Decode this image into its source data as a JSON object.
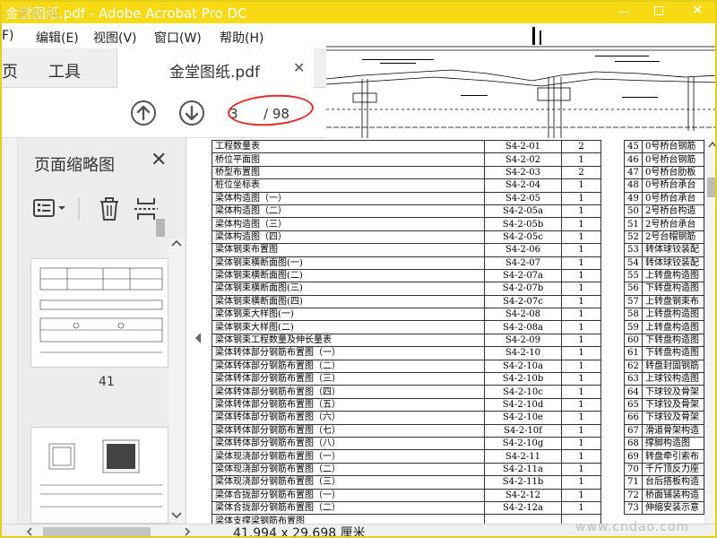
{
  "window": {
    "title": "金堂图纸.pdf - Adobe Acrobat Pro DC",
    "watermark_top": "清新网",
    "close_glyph": "✕"
  },
  "menu": {
    "items": [
      "F)",
      "编辑(E)",
      "视图(V)",
      "窗口(W)",
      "帮助(H)"
    ]
  },
  "tabs": {
    "home": "页",
    "tools": "工具",
    "document": "金堂图纸.pdf",
    "close_glyph": "✕"
  },
  "toolbar": {
    "prev_icon": "arrow-up-icon",
    "next_icon": "arrow-down-icon",
    "page_current": "3",
    "page_total": "/ 98"
  },
  "thumbnail_panel": {
    "title": "页面缩略图",
    "close_glyph": "✕",
    "page_label": "41"
  },
  "document": {
    "left_rows": [
      {
        "name": "工程数量表",
        "code": "S4-2-01",
        "sheets": "2"
      },
      {
        "name": "桥位平面图",
        "code": "S4-2-02",
        "sheets": "1"
      },
      {
        "name": "桥型布置图",
        "code": "S4-2-03",
        "sheets": "2"
      },
      {
        "name": "桩位坐标表",
        "code": "S4-2-04",
        "sheets": "1"
      },
      {
        "name": "梁体构造图（一）",
        "code": "S4-2-05",
        "sheets": "1"
      },
      {
        "name": "梁体构造图（二）",
        "code": "S4-2-05a",
        "sheets": "1"
      },
      {
        "name": "梁体构造图（三）",
        "code": "S4-2-05b",
        "sheets": "1"
      },
      {
        "name": "梁体构造图（四）",
        "code": "S4-2-05c",
        "sheets": "1"
      },
      {
        "name": "梁体钢束布置图",
        "code": "S4-2-06",
        "sheets": "1"
      },
      {
        "name": "梁体钢束横断面图(一)",
        "code": "S4-2-07",
        "sheets": "1"
      },
      {
        "name": "梁体钢束横断面图(二)",
        "code": "S4-2-07a",
        "sheets": "1"
      },
      {
        "name": "梁体钢束横断面图(三)",
        "code": "S4-2-07b",
        "sheets": "1"
      },
      {
        "name": "梁体钢束横断面图(四)",
        "code": "S4-2-07c",
        "sheets": "1"
      },
      {
        "name": "梁体钢束大样图(一)",
        "code": "S4-2-08",
        "sheets": "1"
      },
      {
        "name": "梁体钢束大样图(二)",
        "code": "S4-2-08a",
        "sheets": "1"
      },
      {
        "name": "梁体钢束工程数量及伸长量表",
        "code": "S4-2-09",
        "sheets": "1"
      },
      {
        "name": "梁体转体部分钢筋布置图（一）",
        "code": "S4-2-10",
        "sheets": "1"
      },
      {
        "name": "梁体转体部分钢筋布置图（二）",
        "code": "S4-2-10a",
        "sheets": "1"
      },
      {
        "name": "梁体转体部分钢筋布置图（三）",
        "code": "S4-2-10b",
        "sheets": "1"
      },
      {
        "name": "梁体转体部分钢筋布置图（四）",
        "code": "S4-2-10c",
        "sheets": "1"
      },
      {
        "name": "梁体转体部分钢筋布置图（五）",
        "code": "S4-2-10d",
        "sheets": "1"
      },
      {
        "name": "梁体转体部分钢筋布置图（六）",
        "code": "S4-2-10e",
        "sheets": "1"
      },
      {
        "name": "梁体转体部分钢筋布置图（七）",
        "code": "S4-2-10f",
        "sheets": "1"
      },
      {
        "name": "梁体转体部分钢筋布置图（八）",
        "code": "S4-2-10g",
        "sheets": "1"
      },
      {
        "name": "梁体现浇部分钢筋布置图（一）",
        "code": "S4-2-11",
        "sheets": "1"
      },
      {
        "name": "梁体现浇部分钢筋布置图（二）",
        "code": "S4-2-11a",
        "sheets": "1"
      },
      {
        "name": "梁体现浇部分钢筋布置图（三）",
        "code": "S4-2-11b",
        "sheets": "1"
      },
      {
        "name": "梁体合拢部分钢筋布置图（一）",
        "code": "S4-2-12",
        "sheets": "1"
      },
      {
        "name": "梁体合拢部分钢筋布置图（二）",
        "code": "S4-2-12a",
        "sheets": "1"
      }
    ],
    "right_rows": [
      {
        "num": "45",
        "name": "0号桥台钢筋"
      },
      {
        "num": "46",
        "name": "0号桥台钢筋"
      },
      {
        "num": "47",
        "name": "0号桥台肋板"
      },
      {
        "num": "48",
        "name": "0号桥台承台"
      },
      {
        "num": "49",
        "name": "0号桥台承台"
      },
      {
        "num": "50",
        "name": "2号桥台构造"
      },
      {
        "num": "51",
        "name": "2号桥台承台"
      },
      {
        "num": "52",
        "name": "2号台帽钢筋"
      },
      {
        "num": "53",
        "name": "转体球铰装配"
      },
      {
        "num": "54",
        "name": "转体球铰装配"
      },
      {
        "num": "55",
        "name": "上转盘构造图"
      },
      {
        "num": "56",
        "name": "下转盘构造图"
      },
      {
        "num": "57",
        "name": "上转盘钢束布"
      },
      {
        "num": "58",
        "name": "上转盘构造图"
      },
      {
        "num": "59",
        "name": "上转盘构造图"
      },
      {
        "num": "60",
        "name": "下转盘构造图"
      },
      {
        "num": "61",
        "name": "下转盘构造图"
      },
      {
        "num": "62",
        "name": "转盘封固钢筋"
      },
      {
        "num": "63",
        "name": "上球铰构造图"
      },
      {
        "num": "64",
        "name": "下球铰及骨架"
      },
      {
        "num": "65",
        "name": "下球铰及骨架"
      },
      {
        "num": "66",
        "name": "下球铰及骨架"
      },
      {
        "num": "67",
        "name": "滑道骨架构造"
      },
      {
        "num": "68",
        "name": "撑脚构造图"
      },
      {
        "num": "69",
        "name": "转盘牵引索布"
      },
      {
        "num": "70",
        "name": "千斤顶反力座"
      },
      {
        "num": "71",
        "name": "台后搭板构造"
      },
      {
        "num": "72",
        "name": "桥面铺装构造"
      },
      {
        "num": "73",
        "name": "伸缩安装示意"
      }
    ],
    "partial_row": "梁体支撑梁钢筋布置图"
  },
  "status": {
    "page_size": "41.994 x 29.698 厘米",
    "watermark": "www.cndao.com"
  }
}
